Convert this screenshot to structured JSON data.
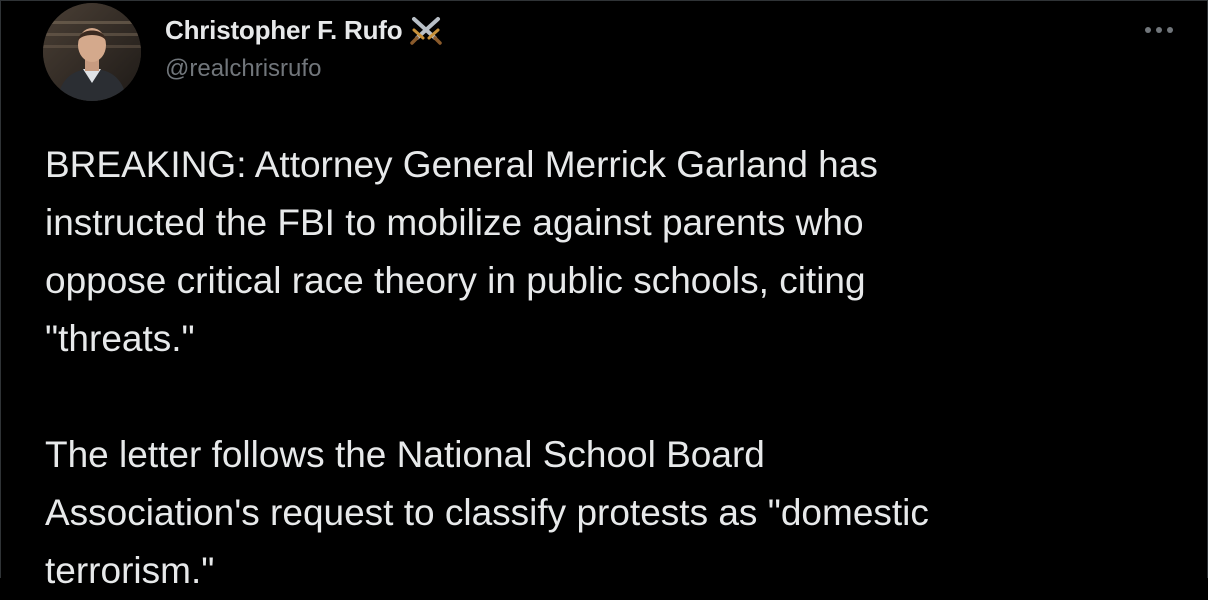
{
  "tweet": {
    "author": {
      "display_name": "Christopher F. Rufo",
      "badge_icon": "crossed-swords-icon",
      "handle": "@realchrisrufo"
    },
    "more_icon": "more-options-icon",
    "paragraphs": [
      "BREAKING: Attorney General Merrick Garland has\ninstructed the FBI to mobilize against parents who\noppose critical race theory in public schools, citing\n\"threats.\"",
      "The letter follows the National School Board\nAssociation's request to classify protests as \"domestic\nterrorism.\""
    ]
  },
  "colors": {
    "background": "#000000",
    "text_primary": "#e7e9ea",
    "text_secondary": "#71767b",
    "border": "#2f3336"
  }
}
